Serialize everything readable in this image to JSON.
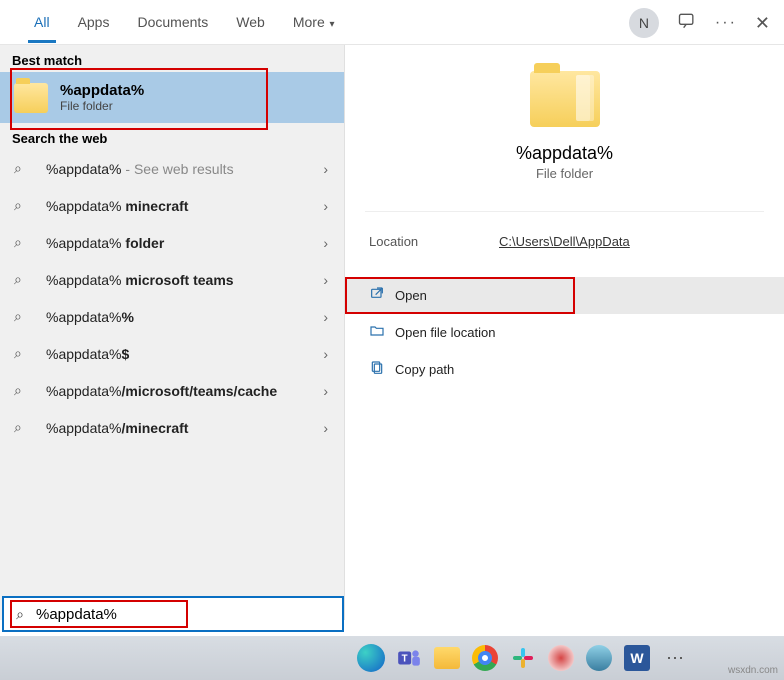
{
  "tabs": {
    "all": "All",
    "apps": "Apps",
    "documents": "Documents",
    "web": "Web",
    "more": "More"
  },
  "avatar_initial": "N",
  "left": {
    "best_label": "Best match",
    "best_title": "%appdata%",
    "best_sub": "File folder",
    "search_label": "Search the web",
    "sug": [
      {
        "text": "%appdata%",
        "tail": " - See web results",
        "bold": false
      },
      {
        "text": "%appdata% ",
        "tail": "minecraft",
        "bold": true
      },
      {
        "text": "%appdata% ",
        "tail": "folder",
        "bold": true
      },
      {
        "text": "%appdata% ",
        "tail": "microsoft teams",
        "bold": true
      },
      {
        "text": "%appdata%",
        "tail": "%",
        "bold": true
      },
      {
        "text": "%appdata%",
        "tail": "$",
        "bold": true
      },
      {
        "text": "%appdata%",
        "tail": "/microsoft/teams/cache",
        "bold": true
      },
      {
        "text": "%appdata%",
        "tail": "/minecraft",
        "bold": true
      }
    ]
  },
  "preview": {
    "title": "%appdata%",
    "sub": "File folder",
    "location_label": "Location",
    "location_value": "C:\\Users\\Dell\\AppData",
    "actions": {
      "open": "Open",
      "openloc": "Open file location",
      "copy": "Copy path"
    }
  },
  "search_value": "%appdata%",
  "watermark": "wsxdn.com"
}
